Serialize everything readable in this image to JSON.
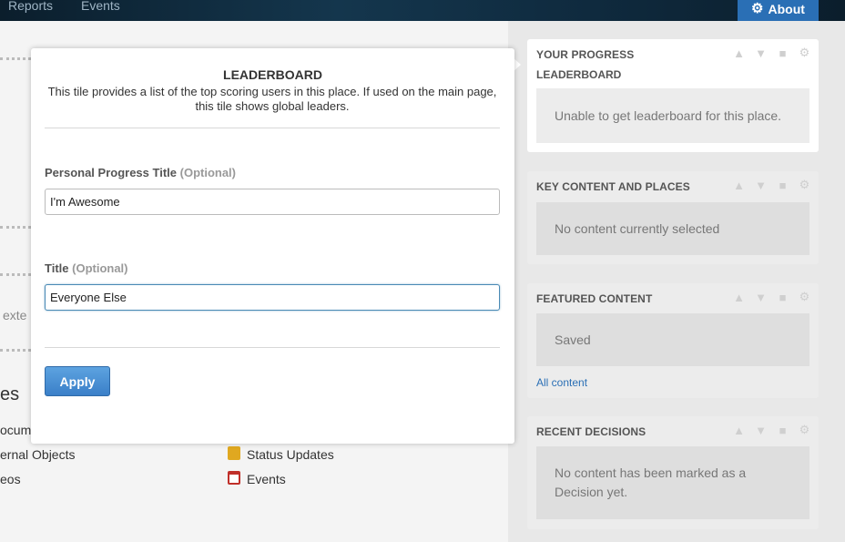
{
  "nav": {
    "reports_label": "Reports",
    "events_label": "Events",
    "about_label": "About",
    "about_icon": "gear-icon"
  },
  "background": {
    "partial_text": "exte",
    "section_heading": "es",
    "content_types": [
      {
        "label": "ocume"
      },
      {
        "label": "ernal Objects"
      },
      {
        "label": "eos"
      },
      {
        "label": "Status Updates",
        "icon": "status-updates-icon",
        "color": "#e0a820"
      },
      {
        "label": "Events",
        "icon": "calendar-icon",
        "color": "#c0302a"
      }
    ]
  },
  "sidebar": {
    "tiles": [
      {
        "title": "YOUR PROGRESS",
        "subtitle": "LEADERBOARD",
        "message": "Unable to get leaderboard for this place."
      },
      {
        "title": "KEY CONTENT AND PLACES",
        "message": "No content currently selected"
      },
      {
        "title": "FEATURED CONTENT",
        "message": "Saved",
        "link": "All content"
      },
      {
        "title": "RECENT DECISIONS",
        "message": "No content has been marked as a Decision yet."
      }
    ],
    "control_icons": [
      "chevron-up-icon",
      "chevron-down-icon",
      "trash-icon",
      "gear-icon"
    ]
  },
  "modal": {
    "title": "LEADERBOARD",
    "description": "This tile provides a list of the top scoring users in this place. If used on the main page, this tile shows global leaders.",
    "fields": [
      {
        "label": "Personal Progress Title",
        "optional": "(Optional)",
        "value": "I'm Awesome"
      },
      {
        "label": "Title",
        "optional": "(Optional)",
        "value": "Everyone Else"
      }
    ],
    "apply_label": "Apply"
  },
  "colors": {
    "accent": "#2a6fb5",
    "nav_bg": "#0b1e2c"
  }
}
